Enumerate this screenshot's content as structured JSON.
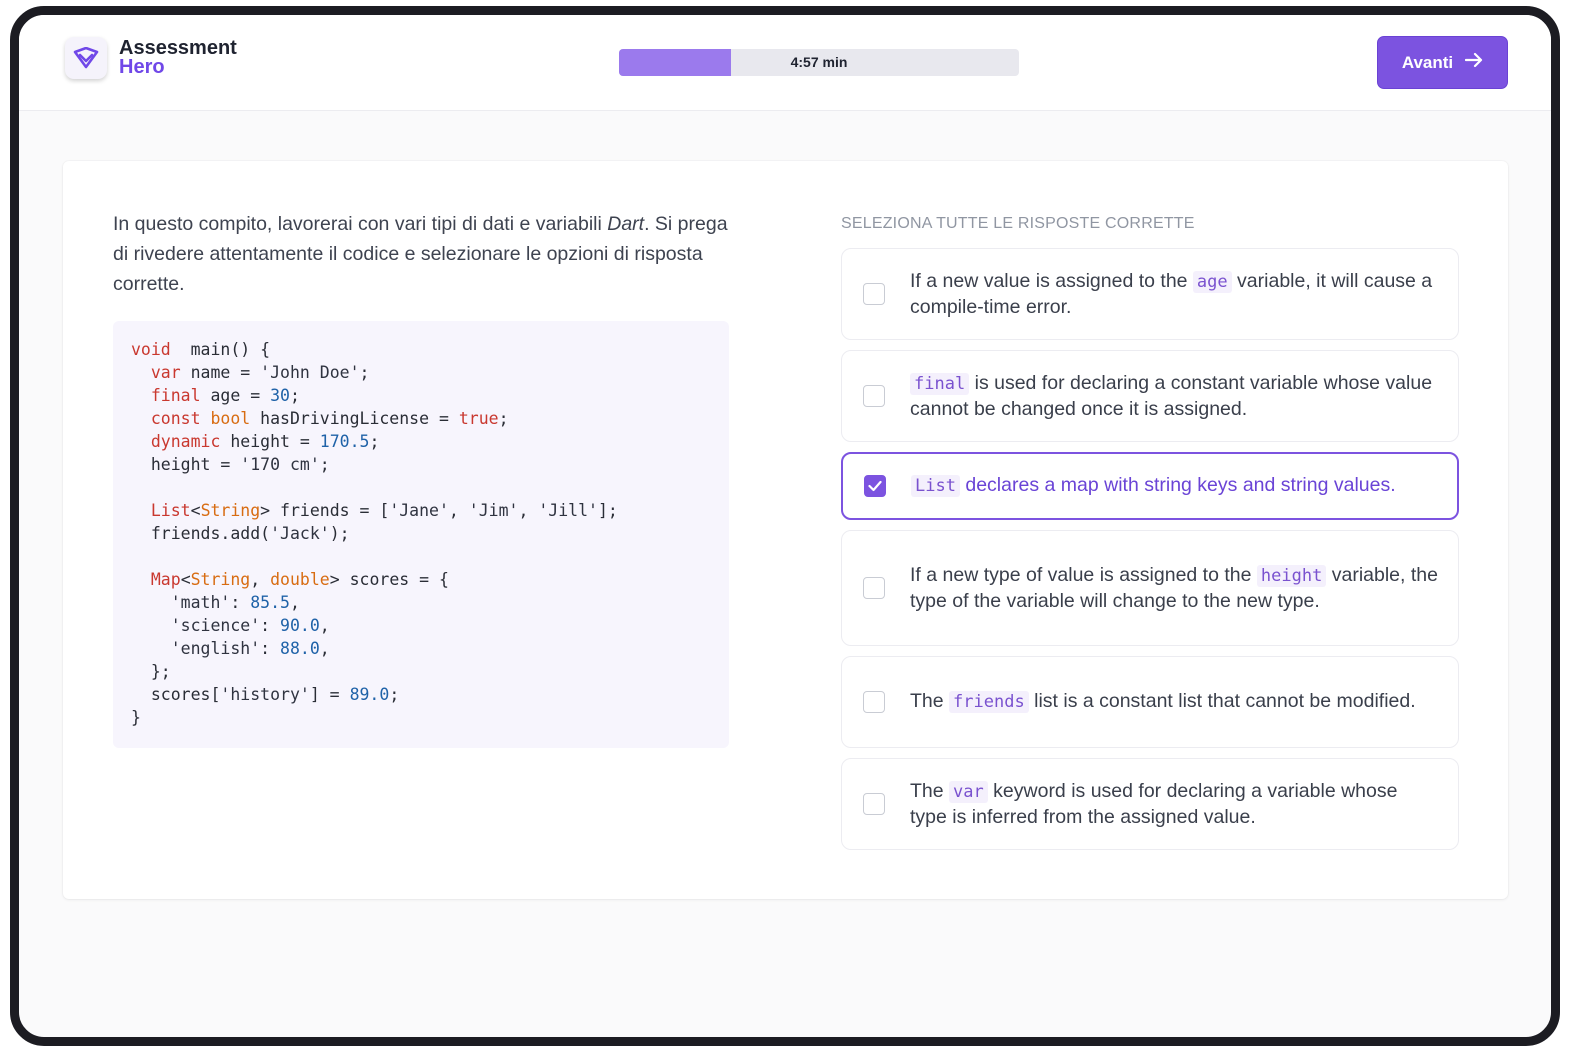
{
  "app": {
    "name_line1": "Assessment",
    "name_line2": "Hero"
  },
  "header": {
    "timer_label": "4:57 min",
    "timer_progress": 0.28,
    "next_button_label": "Avanti",
    "next_button_icon": "arrow-right-icon"
  },
  "task": {
    "intro_before": "In questo compito, lavorerai con vari tipi di dati e variabili ",
    "intro_emphasis": "Dart",
    "intro_after": ". Si prega di rivedere attentamente il codice e selezionare le opzioni di risposta corrette."
  },
  "code_lines": [
    [
      [
        "kw",
        "void"
      ],
      [
        "",
        "  main() {"
      ]
    ],
    [
      [
        "",
        "  "
      ],
      [
        "kw",
        "var"
      ],
      [
        "",
        " name = "
      ],
      [
        "str",
        "'John Doe'"
      ],
      [
        "",
        ";"
      ]
    ],
    [
      [
        "",
        "  "
      ],
      [
        "kw",
        "final"
      ],
      [
        "",
        " age = "
      ],
      [
        "num",
        "30"
      ],
      [
        "",
        ";"
      ]
    ],
    [
      [
        "",
        "  "
      ],
      [
        "kw",
        "const"
      ],
      [
        "",
        " "
      ],
      [
        "ty",
        "bool"
      ],
      [
        "",
        " hasDrivingLicense = "
      ],
      [
        "kw",
        "true"
      ],
      [
        "",
        ";"
      ]
    ],
    [
      [
        "",
        "  "
      ],
      [
        "kw",
        "dynamic"
      ],
      [
        "",
        " height = "
      ],
      [
        "num",
        "170.5"
      ],
      [
        "",
        ";"
      ]
    ],
    [
      [
        "",
        "  height = "
      ],
      [
        "str",
        "'170 cm'"
      ],
      [
        "",
        ";"
      ]
    ],
    [
      [
        "",
        ""
      ]
    ],
    [
      [
        "",
        "  "
      ],
      [
        "kw",
        "List"
      ],
      [
        "",
        "<"
      ],
      [
        "ty",
        "String"
      ],
      [
        "",
        "> friends = ["
      ],
      [
        "str",
        "'Jane'"
      ],
      [
        "",
        ", "
      ],
      [
        "str",
        "'Jim'"
      ],
      [
        "",
        ", "
      ],
      [
        "str",
        "'Jill'"
      ],
      [
        "",
        "];"
      ]
    ],
    [
      [
        "",
        "  friends.add("
      ],
      [
        "str",
        "'Jack'"
      ],
      [
        "",
        ");"
      ]
    ],
    [
      [
        "",
        ""
      ]
    ],
    [
      [
        "",
        "  "
      ],
      [
        "kw",
        "Map"
      ],
      [
        "",
        "<"
      ],
      [
        "ty",
        "String"
      ],
      [
        "",
        ", "
      ],
      [
        "ty",
        "double"
      ],
      [
        "",
        "> scores = {"
      ]
    ],
    [
      [
        "",
        "    "
      ],
      [
        "str",
        "'math'"
      ],
      [
        "",
        ": "
      ],
      [
        "num",
        "85.5"
      ],
      [
        "",
        ","
      ]
    ],
    [
      [
        "",
        "    "
      ],
      [
        "str",
        "'science'"
      ],
      [
        "",
        ": "
      ],
      [
        "num",
        "90.0"
      ],
      [
        "",
        ","
      ]
    ],
    [
      [
        "",
        "    "
      ],
      [
        "str",
        "'english'"
      ],
      [
        "",
        ": "
      ],
      [
        "num",
        "88.0"
      ],
      [
        "",
        ","
      ]
    ],
    [
      [
        "",
        "  };"
      ]
    ],
    [
      [
        "",
        "  scores["
      ],
      [
        "str",
        "'history'"
      ],
      [
        "",
        "] = "
      ],
      [
        "num",
        "89.0"
      ],
      [
        "",
        ";"
      ]
    ],
    [
      [
        "",
        "}"
      ]
    ]
  ],
  "answers": {
    "title": "SELEZIONA TUTTE LE RISPOSTE CORRETTE",
    "options": [
      {
        "parts": [
          [
            "t",
            "If a new value is assigned to the "
          ],
          [
            "c",
            "age"
          ],
          [
            "t",
            " variable, it will cause a compile-time error."
          ]
        ],
        "checked": false
      },
      {
        "parts": [
          [
            "c",
            "final"
          ],
          [
            "t",
            " is used for declaring a constant variable whose value cannot be changed once it is assigned."
          ]
        ],
        "checked": false
      },
      {
        "parts": [
          [
            "c",
            "List"
          ],
          [
            "t",
            " declares a map with string keys and string values."
          ]
        ],
        "checked": true
      },
      {
        "parts": [
          [
            "t",
            "If a new type of value is assigned to the "
          ],
          [
            "c",
            "height"
          ],
          [
            "t",
            " variable, the type of the variable will change to the new type."
          ]
        ],
        "checked": false
      },
      {
        "parts": [
          [
            "t",
            "The "
          ],
          [
            "c",
            "friends"
          ],
          [
            "t",
            " list is a constant list that cannot be modified."
          ]
        ],
        "checked": false
      },
      {
        "parts": [
          [
            "t",
            "The "
          ],
          [
            "c",
            "var"
          ],
          [
            "t",
            " keyword is used for declaring a variable whose type is inferred from the assigned value."
          ]
        ],
        "checked": false
      }
    ]
  },
  "colors": {
    "accent": "#7c53e0",
    "keyword": "#c9382f",
    "type": "#d86c12",
    "number": "#1f62a8"
  }
}
